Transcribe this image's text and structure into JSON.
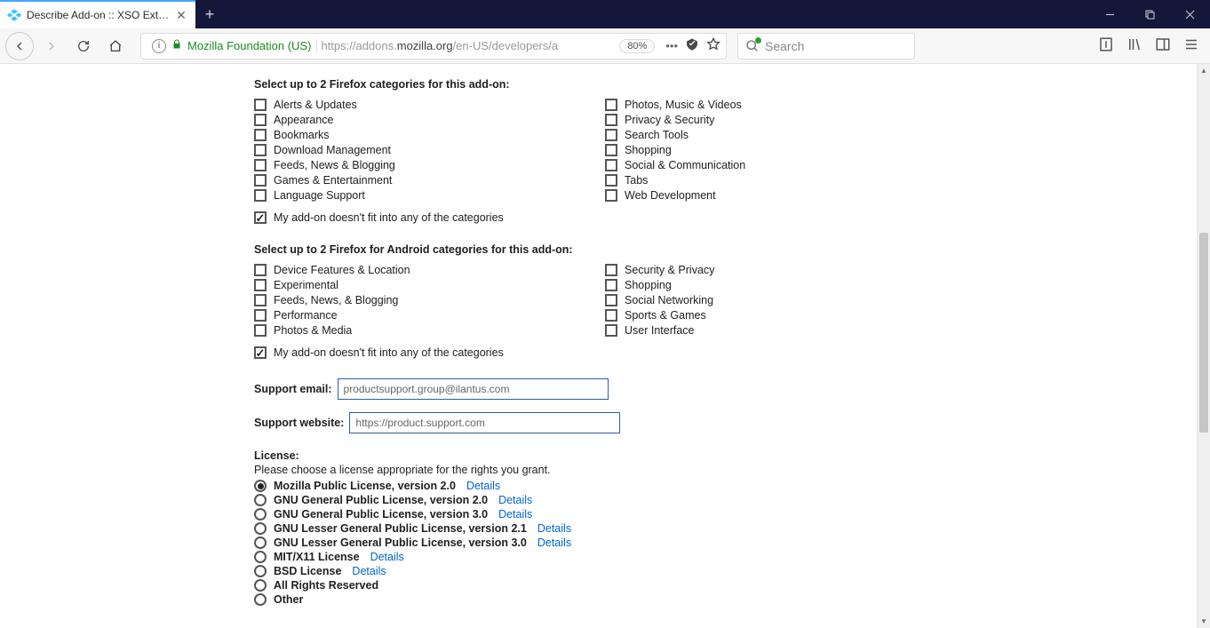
{
  "browser": {
    "tab_title": "Describe Add-on :: XSO Extensi",
    "site_identity": "Mozilla Foundation (US)",
    "url_prefix": "https://addons.",
    "url_host": "mozilla.org",
    "url_path": "/en-US/developers/a",
    "zoom": "80%",
    "search_placeholder": "Search"
  },
  "firefox_categories": {
    "heading": "Select up to 2 Firefox categories for this add-on:",
    "left": [
      "Alerts & Updates",
      "Appearance",
      "Bookmarks",
      "Download Management",
      "Feeds, News & Blogging",
      "Games & Entertainment",
      "Language Support"
    ],
    "right": [
      "Photos, Music & Videos",
      "Privacy & Security",
      "Search Tools",
      "Shopping",
      "Social & Communication",
      "Tabs",
      "Web Development"
    ],
    "nofit": "My add-on doesn't fit into any of the categories",
    "nofit_checked": true
  },
  "android_categories": {
    "heading": "Select up to 2 Firefox for Android categories for this add-on:",
    "left": [
      "Device Features & Location",
      "Experimental",
      "Feeds, News, & Blogging",
      "Performance",
      "Photos & Media"
    ],
    "right": [
      "Security & Privacy",
      "Shopping",
      "Social Networking",
      "Sports & Games",
      "User Interface"
    ],
    "nofit": "My add-on doesn't fit into any of the categories",
    "nofit_checked": true
  },
  "support": {
    "email_label": "Support email:",
    "email_value": "productsupport.group@ilantus.com",
    "website_label": "Support website:",
    "website_value": "https://product.support.com"
  },
  "license": {
    "heading": "License:",
    "sub": "Please choose a license appropriate for the rights you grant.",
    "details_label": "Details",
    "options": [
      {
        "label": "Mozilla Public License, version 2.0",
        "details": true,
        "selected": true
      },
      {
        "label": "GNU General Public License, version 2.0",
        "details": true,
        "selected": false
      },
      {
        "label": "GNU General Public License, version 3.0",
        "details": true,
        "selected": false
      },
      {
        "label": "GNU Lesser General Public License, version 2.1",
        "details": true,
        "selected": false
      },
      {
        "label": "GNU Lesser General Public License, version 3.0",
        "details": true,
        "selected": false
      },
      {
        "label": "MIT/X11 License",
        "details": true,
        "selected": false
      },
      {
        "label": "BSD License",
        "details": true,
        "selected": false
      },
      {
        "label": "All Rights Reserved",
        "details": false,
        "selected": false
      },
      {
        "label": "Other",
        "details": false,
        "selected": false
      }
    ]
  }
}
